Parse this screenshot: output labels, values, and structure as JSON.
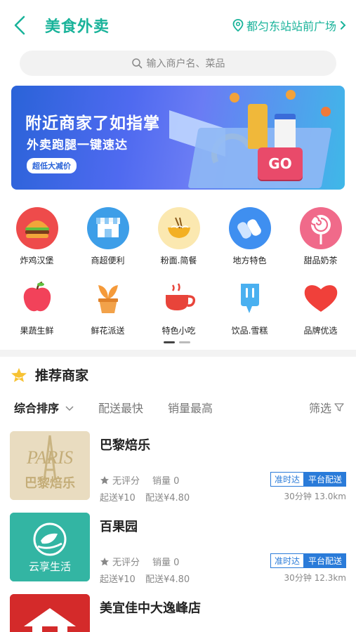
{
  "header": {
    "title": "美食外卖",
    "location": "都匀东站站前广场"
  },
  "search": {
    "placeholder": "输入商户名、菜品"
  },
  "banner": {
    "line1": "附近商家了如指掌",
    "line2": "外卖跑腿一键速达",
    "badge": "超低大减价",
    "go": "GO"
  },
  "categories": [
    {
      "label": "炸鸡汉堡",
      "icon": "burger-icon"
    },
    {
      "label": "商超便利",
      "icon": "store-icon"
    },
    {
      "label": "粉面.简餐",
      "icon": "noodle-bowl-icon"
    },
    {
      "label": "地方特色",
      "icon": "local-special-icon"
    },
    {
      "label": "甜品奶茶",
      "icon": "lollipop-icon"
    },
    {
      "label": "果蔬生鲜",
      "icon": "apple-icon"
    },
    {
      "label": "鲜花派送",
      "icon": "flower-pot-icon"
    },
    {
      "label": "特色小吃",
      "icon": "teacup-icon"
    },
    {
      "label": "饮品.雪糕",
      "icon": "popsicle-icon"
    },
    {
      "label": "品牌优选",
      "icon": "heart-icon"
    }
  ],
  "recommend": {
    "title": "推荐商家"
  },
  "sort": {
    "default": "综合排序",
    "fastest": "配送最快",
    "sales": "销量最高",
    "filter": "筛选"
  },
  "shops": [
    {
      "name": "巴黎焙乐",
      "rating": "无评分",
      "sales": "销量 0",
      "min_order": "起送¥10",
      "delivery_fee": "配送¥4.80",
      "tag_ontime": "准时达",
      "tag_platform": "平台配送",
      "eta": "30分钟 13.0km",
      "logo_text": "PARIS",
      "logo_sub": "巴黎焙乐"
    },
    {
      "name": "百果园",
      "rating": "无评分",
      "sales": "销量 0",
      "min_order": "起送¥10",
      "delivery_fee": "配送¥4.80",
      "tag_ontime": "准时达",
      "tag_platform": "平台配送",
      "eta": "30分钟 12.3km",
      "logo_text": "云享生活"
    },
    {
      "name": "美宜佳中大逸峰店"
    }
  ],
  "colors": {
    "accent": "#19b39a",
    "tag_blue": "#2a7bd9"
  }
}
